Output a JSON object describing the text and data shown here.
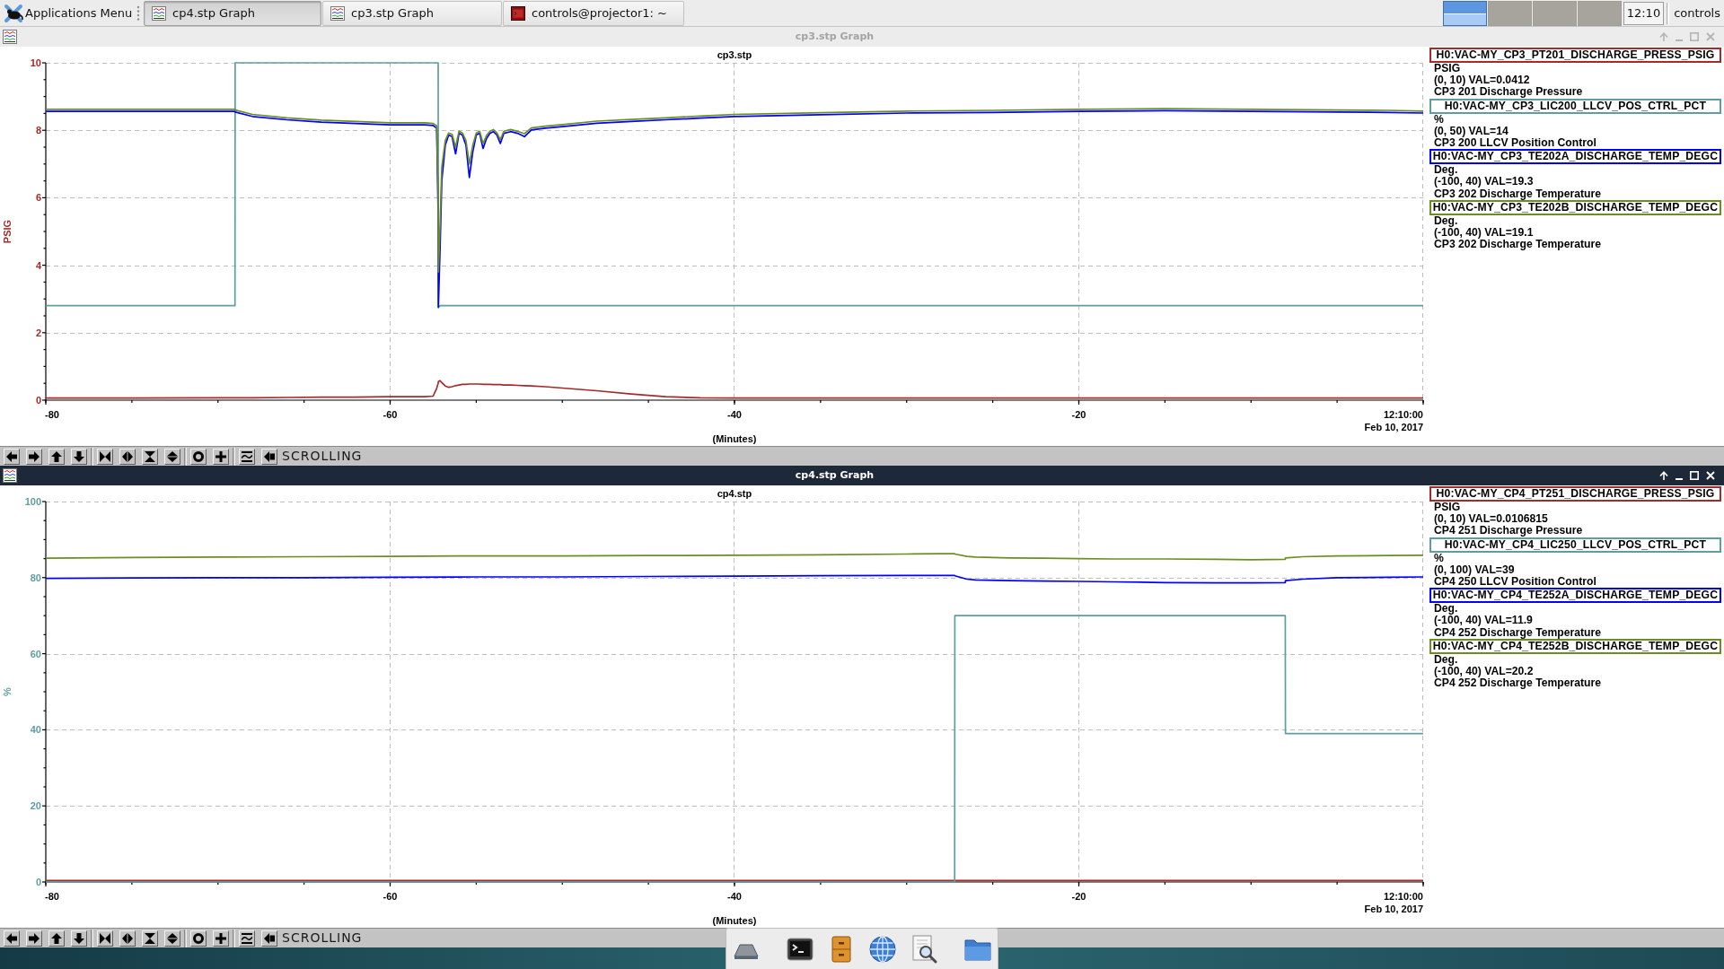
{
  "taskbar": {
    "app_menu": "Applications Menu",
    "tasks": [
      {
        "label": "cp4.stp Graph",
        "kind": "graph",
        "selected": true
      },
      {
        "label": "cp3.stp Graph",
        "kind": "graph",
        "selected": false
      },
      {
        "label": "controls@projector1: ~",
        "kind": "terminal",
        "selected": false
      }
    ],
    "workspaces": [
      {
        "selected": true
      },
      {
        "selected": false
      },
      {
        "selected": false
      },
      {
        "selected": false
      }
    ],
    "clock": "12:10",
    "user": "controls"
  },
  "windows": [
    {
      "title": "cp3.stp Graph",
      "active": false,
      "chart_data": {
        "type": "line",
        "title": "cp3.stp",
        "xlabel": "(Minutes)",
        "ylabel": "PSIG",
        "x": [
          -80,
          -75,
          -70,
          -69.01,
          -69,
          -68,
          -66,
          -64,
          -62,
          -60,
          -58,
          -57.5,
          -57.3,
          -57.21,
          -57.2,
          -57.1,
          -57,
          -56.8,
          -56.6,
          -56.4,
          -56.2,
          -56,
          -55.8,
          -55.6,
          -55.4,
          -55.2,
          -55,
          -54.8,
          -54.6,
          -54.4,
          -54.2,
          -54,
          -53.8,
          -53.6,
          -53.4,
          -53,
          -52.6,
          -52.2,
          -51.8,
          -51,
          -50,
          -48,
          -46,
          -44,
          -42,
          -40,
          -35,
          -30,
          -25,
          -20,
          -15,
          -10,
          -5,
          -2,
          0
        ],
        "series": [
          {
            "name": "H0:VAC-MY_CP3_PT201_DISCHARGE_PRESS_PSIG",
            "color": "#a52a2a",
            "values": [
              0.06,
              0.06,
              0.07,
              0.07,
              0.07,
              0.07,
              0.08,
              0.09,
              0.09,
              0.1,
              0.1,
              0.12,
              0.35,
              0.5,
              0.55,
              0.58,
              0.52,
              0.42,
              0.38,
              0.4,
              0.43,
              0.45,
              0.47,
              0.47,
              0.48,
              0.48,
              0.48,
              0.48,
              0.47,
              0.47,
              0.47,
              0.46,
              0.46,
              0.46,
              0.45,
              0.45,
              0.44,
              0.43,
              0.42,
              0.4,
              0.36,
              0.28,
              0.18,
              0.1,
              0.07,
              0.06,
              0.06,
              0.06,
              0.06,
              0.06,
              0.06,
              0.06,
              0.06,
              0.06,
              0.06
            ]
          },
          {
            "name": "H0:VAC-MY_CP3_LIC200_LLCV_POS_CTRL_PCT",
            "color": "#5f9ea0",
            "values": [
              2.8,
              2.8,
              2.8,
              2.8,
              10,
              10,
              10,
              10,
              10,
              10,
              10,
              10,
              10,
              10,
              2.75,
              2.8,
              2.8,
              2.8,
              2.8,
              2.8,
              2.8,
              2.8,
              2.8,
              2.8,
              2.8,
              2.8,
              2.8,
              2.8,
              2.8,
              2.8,
              2.8,
              2.8,
              2.8,
              2.8,
              2.8,
              2.8,
              2.8,
              2.8,
              2.8,
              2.8,
              2.8,
              2.8,
              2.8,
              2.8,
              2.8,
              2.8,
              2.8,
              2.8,
              2.8,
              2.8,
              2.8,
              2.8,
              2.8,
              2.8,
              2.8
            ]
          },
          {
            "name": "H0:VAC-MY_CP3_TE202A_DISCHARGE_TEMP_DEGC",
            "color": "#0000ff",
            "values": [
              8.56,
              8.56,
              8.56,
              8.56,
              8.54,
              8.41,
              8.31,
              8.24,
              8.2,
              8.16,
              8.16,
              8.14,
              8.06,
              5.5,
              2.75,
              4.5,
              6.5,
              7.56,
              7.86,
              7.81,
              7.3,
              7.91,
              7.86,
              7.56,
              6.6,
              7.36,
              7.86,
              7.91,
              7.46,
              7.76,
              7.91,
              7.96,
              7.86,
              7.61,
              7.91,
              7.96,
              7.91,
              7.81,
              8.01,
              8.06,
              8.11,
              8.21,
              8.26,
              8.31,
              8.36,
              8.41,
              8.46,
              8.51,
              8.53,
              8.56,
              8.58,
              8.56,
              8.54,
              8.53,
              8.51
            ]
          },
          {
            "name": "H0:VAC-MY_CP3_TE202B_DISCHARGE_TEMP_DEGC",
            "color": "#6b8e23",
            "values": [
              8.62,
              8.62,
              8.62,
              8.62,
              8.6,
              8.47,
              8.37,
              8.3,
              8.26,
              8.22,
              8.22,
              8.2,
              8.13,
              6.2,
              3.8,
              5.2,
              6.9,
              7.7,
              7.92,
              7.88,
              7.5,
              7.97,
              7.92,
              7.7,
              7.0,
              7.55,
              7.92,
              7.97,
              7.6,
              7.85,
              7.97,
              8.02,
              7.92,
              7.72,
              7.97,
              8.02,
              7.97,
              7.9,
              8.07,
              8.12,
              8.17,
              8.27,
              8.32,
              8.37,
              8.42,
              8.47,
              8.52,
              8.57,
              8.59,
              8.62,
              8.64,
              8.62,
              8.6,
              8.59,
              8.57
            ]
          }
        ],
        "xlim": [
          -80,
          0
        ],
        "ylim": [
          0,
          10
        ],
        "xticks": [
          -80,
          -60,
          -40,
          -20
        ],
        "yticks": [
          0,
          2,
          4,
          6,
          8,
          10
        ],
        "grid": true
      },
      "y_axis": {
        "color": "#a52a2a"
      },
      "time_label": "12:10:00",
      "date_label": "Feb 10, 2017",
      "legend": [
        {
          "unit": "PSIG",
          "reading": "(0, 10) VAL=0.0412",
          "description": "CP3 201 Discharge Pressure"
        },
        {
          "unit": "%",
          "reading": "(0, 50) VAL=14",
          "description": "CP3 200 LLCV Position Control"
        },
        {
          "unit": "Deg.",
          "reading": "(-100, 40) VAL=19.3",
          "description": "CP3 202 Discharge Temperature"
        },
        {
          "unit": "Deg.",
          "reading": "(-100, 40) VAL=19.1",
          "description": "CP3 202 Discharge Temperature"
        }
      ],
      "toolbar": {
        "mode": "SCROLLING"
      }
    },
    {
      "title": "cp4.stp Graph",
      "active": true,
      "chart_data": {
        "type": "line",
        "title": "cp4.stp",
        "xlabel": "(Minutes)",
        "ylabel": "%",
        "x": [
          -80,
          -75,
          -70,
          -65,
          -60,
          -55,
          -50,
          -45,
          -40,
          -35,
          -30,
          -28,
          -27.21,
          -27.2,
          -26.5,
          -26,
          -24,
          -22,
          -20,
          -18,
          -15,
          -12,
          -10,
          -8.01,
          -8,
          -7,
          -5,
          -2,
          0
        ],
        "series": [
          {
            "name": "H0:VAC-MY_CP4_PT251_DISCHARGE_PRESS_PSIG",
            "color": "#a52a2a",
            "values": [
              0.4,
              0.4,
              0.4,
              0.4,
              0.4,
              0.4,
              0.4,
              0.4,
              0.4,
              0.4,
              0.4,
              0.4,
              0.4,
              0.4,
              0.4,
              0.4,
              0.4,
              0.4,
              0.4,
              0.4,
              0.4,
              0.4,
              0.4,
              0.4,
              0.4,
              0.4,
              0.4,
              0.4,
              0.4
            ]
          },
          {
            "name": "H0:VAC-MY_CP4_LIC250_LLCV_POS_CTRL_PCT",
            "color": "#5f9ea0",
            "values": [
              0,
              0,
              0,
              0,
              0,
              0,
              0,
              0,
              0,
              0,
              0,
              0,
              0,
              70,
              70,
              70,
              70,
              70,
              70,
              70,
              70,
              70,
              70,
              70,
              39,
              39,
              39,
              39,
              39
            ]
          },
          {
            "name": "H0:VAC-MY_CP4_TE252A_DISCHARGE_TEMP_DEGC",
            "color": "#0000ff",
            "values": [
              79.8,
              79.9,
              80,
              80,
              80.1,
              80.2,
              80.2,
              80.3,
              80.4,
              80.5,
              80.6,
              80.6,
              80.6,
              80.5,
              79.6,
              79.4,
              79.2,
              79.1,
              79,
              78.9,
              78.7,
              78.6,
              78.6,
              78.7,
              79.2,
              79.6,
              80,
              80.1,
              80.2
            ]
          },
          {
            "name": "H0:VAC-MY_CP4_TE252B_DISCHARGE_TEMP_DEGC",
            "color": "#6b8e23",
            "values": [
              85.1,
              85.3,
              85.4,
              85.5,
              85.6,
              85.7,
              85.7,
              85.8,
              85.9,
              86,
              86.2,
              86.3,
              86.3,
              86.2,
              85.6,
              85.4,
              85.2,
              85.1,
              85,
              84.9,
              84.9,
              84.8,
              84.7,
              84.8,
              85.2,
              85.5,
              85.7,
              85.8,
              85.9
            ]
          }
        ],
        "xlim": [
          -80,
          0
        ],
        "ylim": [
          0,
          100
        ],
        "xticks": [
          -80,
          -60,
          -40,
          -20
        ],
        "yticks": [
          0,
          20,
          40,
          60,
          80,
          100
        ],
        "grid": true
      },
      "y_axis": {
        "color": "#5f9ea0"
      },
      "time_label": "12:10:00",
      "date_label": "Feb 10, 2017",
      "legend": [
        {
          "unit": "PSIG",
          "reading": "(0, 10) VAL=0.0106815",
          "description": "CP4 251 Discharge Pressure"
        },
        {
          "unit": "%",
          "reading": "(0, 100) VAL=39",
          "description": "CP4 250 LLCV Position Control"
        },
        {
          "unit": "Deg.",
          "reading": "(-100, 40) VAL=11.9",
          "description": "CP4 252 Discharge Temperature"
        },
        {
          "unit": "Deg.",
          "reading": "(-100, 40) VAL=20.2",
          "description": "CP4 252 Discharge Temperature"
        }
      ],
      "toolbar": {
        "mode": "SCROLLING"
      }
    }
  ]
}
